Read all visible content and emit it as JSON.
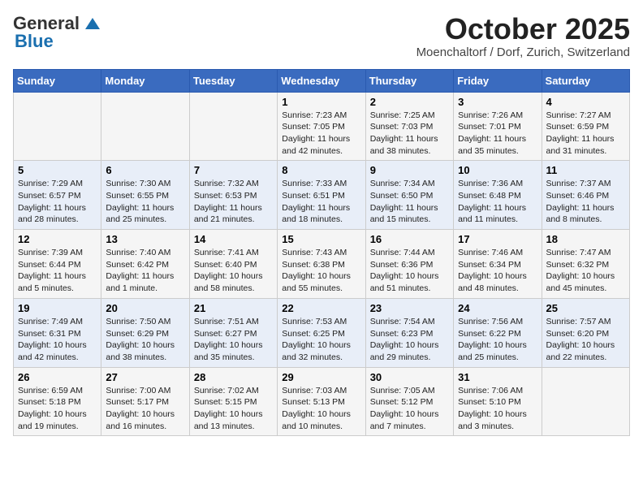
{
  "header": {
    "logo_general": "General",
    "logo_blue": "Blue",
    "month": "October 2025",
    "location": "Moenchaltorf / Dorf, Zurich, Switzerland"
  },
  "days_of_week": [
    "Sunday",
    "Monday",
    "Tuesday",
    "Wednesday",
    "Thursday",
    "Friday",
    "Saturday"
  ],
  "weeks": [
    [
      {
        "day": "",
        "info": ""
      },
      {
        "day": "",
        "info": ""
      },
      {
        "day": "",
        "info": ""
      },
      {
        "day": "1",
        "sunrise": "Sunrise: 7:23 AM",
        "sunset": "Sunset: 7:05 PM",
        "daylight": "Daylight: 11 hours and 42 minutes."
      },
      {
        "day": "2",
        "sunrise": "Sunrise: 7:25 AM",
        "sunset": "Sunset: 7:03 PM",
        "daylight": "Daylight: 11 hours and 38 minutes."
      },
      {
        "day": "3",
        "sunrise": "Sunrise: 7:26 AM",
        "sunset": "Sunset: 7:01 PM",
        "daylight": "Daylight: 11 hours and 35 minutes."
      },
      {
        "day": "4",
        "sunrise": "Sunrise: 7:27 AM",
        "sunset": "Sunset: 6:59 PM",
        "daylight": "Daylight: 11 hours and 31 minutes."
      }
    ],
    [
      {
        "day": "5",
        "sunrise": "Sunrise: 7:29 AM",
        "sunset": "Sunset: 6:57 PM",
        "daylight": "Daylight: 11 hours and 28 minutes."
      },
      {
        "day": "6",
        "sunrise": "Sunrise: 7:30 AM",
        "sunset": "Sunset: 6:55 PM",
        "daylight": "Daylight: 11 hours and 25 minutes."
      },
      {
        "day": "7",
        "sunrise": "Sunrise: 7:32 AM",
        "sunset": "Sunset: 6:53 PM",
        "daylight": "Daylight: 11 hours and 21 minutes."
      },
      {
        "day": "8",
        "sunrise": "Sunrise: 7:33 AM",
        "sunset": "Sunset: 6:51 PM",
        "daylight": "Daylight: 11 hours and 18 minutes."
      },
      {
        "day": "9",
        "sunrise": "Sunrise: 7:34 AM",
        "sunset": "Sunset: 6:50 PM",
        "daylight": "Daylight: 11 hours and 15 minutes."
      },
      {
        "day": "10",
        "sunrise": "Sunrise: 7:36 AM",
        "sunset": "Sunset: 6:48 PM",
        "daylight": "Daylight: 11 hours and 11 minutes."
      },
      {
        "day": "11",
        "sunrise": "Sunrise: 7:37 AM",
        "sunset": "Sunset: 6:46 PM",
        "daylight": "Daylight: 11 hours and 8 minutes."
      }
    ],
    [
      {
        "day": "12",
        "sunrise": "Sunrise: 7:39 AM",
        "sunset": "Sunset: 6:44 PM",
        "daylight": "Daylight: 11 hours and 5 minutes."
      },
      {
        "day": "13",
        "sunrise": "Sunrise: 7:40 AM",
        "sunset": "Sunset: 6:42 PM",
        "daylight": "Daylight: 11 hours and 1 minute."
      },
      {
        "day": "14",
        "sunrise": "Sunrise: 7:41 AM",
        "sunset": "Sunset: 6:40 PM",
        "daylight": "Daylight: 10 hours and 58 minutes."
      },
      {
        "day": "15",
        "sunrise": "Sunrise: 7:43 AM",
        "sunset": "Sunset: 6:38 PM",
        "daylight": "Daylight: 10 hours and 55 minutes."
      },
      {
        "day": "16",
        "sunrise": "Sunrise: 7:44 AM",
        "sunset": "Sunset: 6:36 PM",
        "daylight": "Daylight: 10 hours and 51 minutes."
      },
      {
        "day": "17",
        "sunrise": "Sunrise: 7:46 AM",
        "sunset": "Sunset: 6:34 PM",
        "daylight": "Daylight: 10 hours and 48 minutes."
      },
      {
        "day": "18",
        "sunrise": "Sunrise: 7:47 AM",
        "sunset": "Sunset: 6:32 PM",
        "daylight": "Daylight: 10 hours and 45 minutes."
      }
    ],
    [
      {
        "day": "19",
        "sunrise": "Sunrise: 7:49 AM",
        "sunset": "Sunset: 6:31 PM",
        "daylight": "Daylight: 10 hours and 42 minutes."
      },
      {
        "day": "20",
        "sunrise": "Sunrise: 7:50 AM",
        "sunset": "Sunset: 6:29 PM",
        "daylight": "Daylight: 10 hours and 38 minutes."
      },
      {
        "day": "21",
        "sunrise": "Sunrise: 7:51 AM",
        "sunset": "Sunset: 6:27 PM",
        "daylight": "Daylight: 10 hours and 35 minutes."
      },
      {
        "day": "22",
        "sunrise": "Sunrise: 7:53 AM",
        "sunset": "Sunset: 6:25 PM",
        "daylight": "Daylight: 10 hours and 32 minutes."
      },
      {
        "day": "23",
        "sunrise": "Sunrise: 7:54 AM",
        "sunset": "Sunset: 6:23 PM",
        "daylight": "Daylight: 10 hours and 29 minutes."
      },
      {
        "day": "24",
        "sunrise": "Sunrise: 7:56 AM",
        "sunset": "Sunset: 6:22 PM",
        "daylight": "Daylight: 10 hours and 25 minutes."
      },
      {
        "day": "25",
        "sunrise": "Sunrise: 7:57 AM",
        "sunset": "Sunset: 6:20 PM",
        "daylight": "Daylight: 10 hours and 22 minutes."
      }
    ],
    [
      {
        "day": "26",
        "sunrise": "Sunrise: 6:59 AM",
        "sunset": "Sunset: 5:18 PM",
        "daylight": "Daylight: 10 hours and 19 minutes."
      },
      {
        "day": "27",
        "sunrise": "Sunrise: 7:00 AM",
        "sunset": "Sunset: 5:17 PM",
        "daylight": "Daylight: 10 hours and 16 minutes."
      },
      {
        "day": "28",
        "sunrise": "Sunrise: 7:02 AM",
        "sunset": "Sunset: 5:15 PM",
        "daylight": "Daylight: 10 hours and 13 minutes."
      },
      {
        "day": "29",
        "sunrise": "Sunrise: 7:03 AM",
        "sunset": "Sunset: 5:13 PM",
        "daylight": "Daylight: 10 hours and 10 minutes."
      },
      {
        "day": "30",
        "sunrise": "Sunrise: 7:05 AM",
        "sunset": "Sunset: 5:12 PM",
        "daylight": "Daylight: 10 hours and 7 minutes."
      },
      {
        "day": "31",
        "sunrise": "Sunrise: 7:06 AM",
        "sunset": "Sunset: 5:10 PM",
        "daylight": "Daylight: 10 hours and 3 minutes."
      },
      {
        "day": "",
        "info": ""
      }
    ]
  ]
}
